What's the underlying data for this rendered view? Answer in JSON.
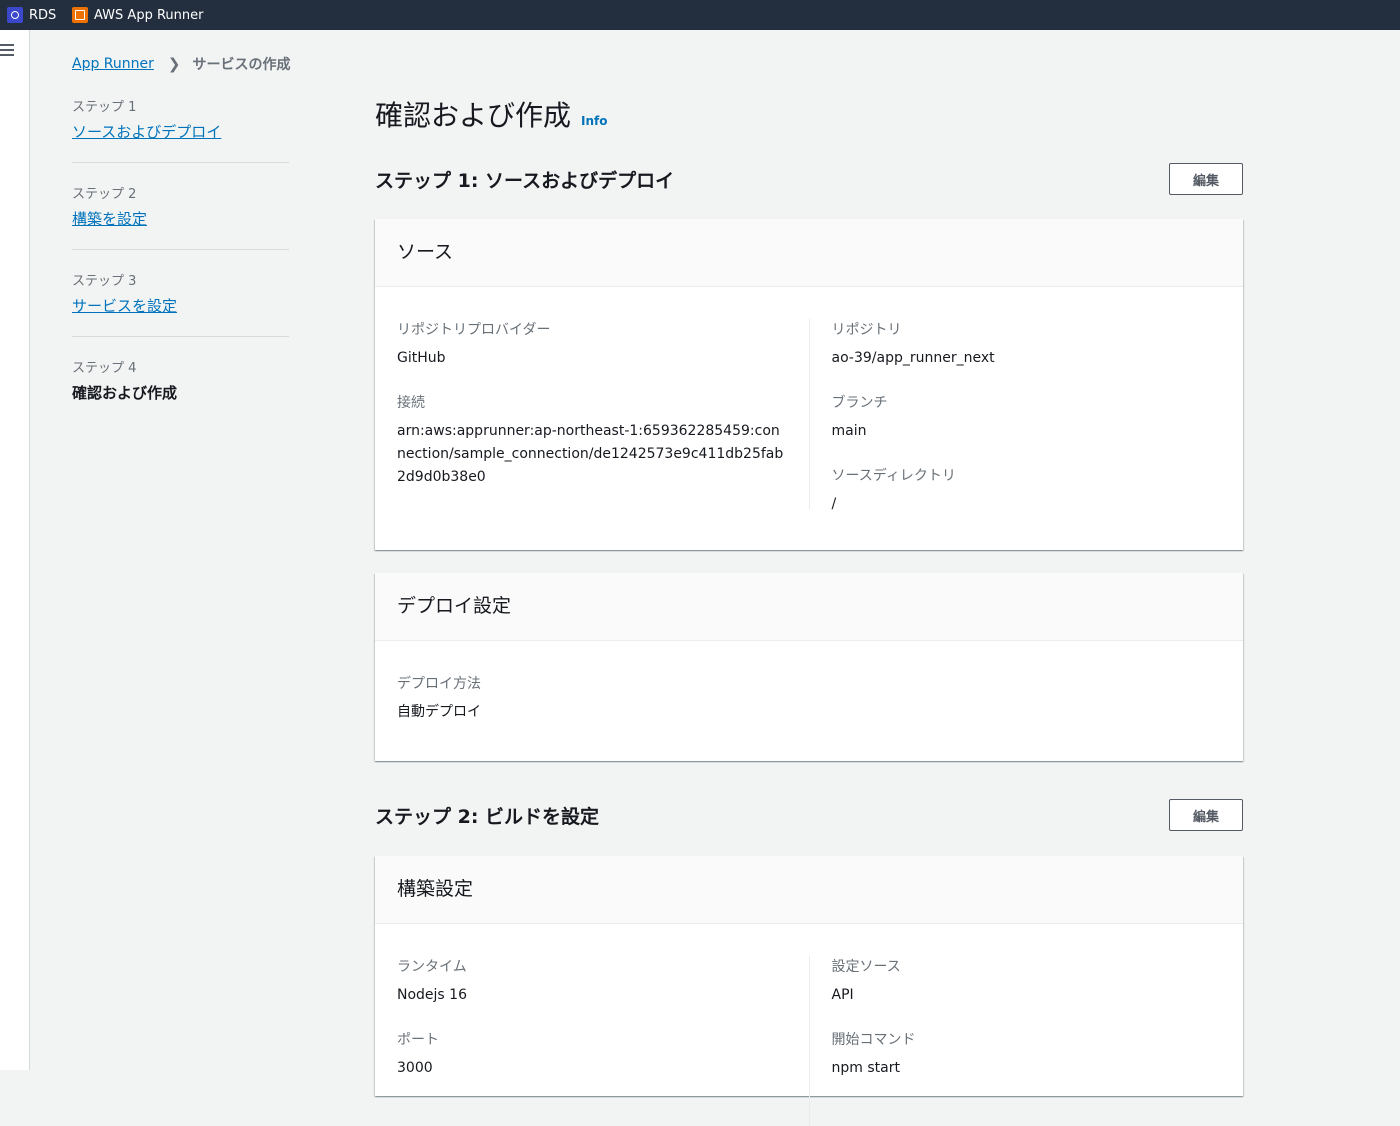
{
  "topbar": {
    "favorites": [
      {
        "icon": "rds-icon",
        "label": "RDS"
      },
      {
        "icon": "app-runner-icon",
        "label": "AWS App Runner"
      }
    ]
  },
  "breadcrumb": {
    "root": "App Runner",
    "current": "サービスの作成"
  },
  "steps": [
    {
      "label": "ステップ 1",
      "name": "ソースおよびデプロイ"
    },
    {
      "label": "ステップ 2",
      "name": "構築を設定"
    },
    {
      "label": "ステップ 3",
      "name": "サービスを設定"
    },
    {
      "label": "ステップ 4",
      "name": "確認および作成"
    }
  ],
  "page": {
    "title": "確認および作成",
    "info": "Info"
  },
  "step1": {
    "heading": "ステップ 1: ソースおよびデプロイ",
    "edit": "編集",
    "source": {
      "title": "ソース",
      "provider_label": "リポジトリプロバイダー",
      "provider_value": "GitHub",
      "connection_label": "接続",
      "connection_value": "arn:aws:apprunner:ap-northeast-1:659362285459:connection/sample_connection/de1242573e9c411db25fab2d9d0b38e0",
      "repo_label": "リポジトリ",
      "repo_value": "ao-39/app_runner_next",
      "branch_label": "ブランチ",
      "branch_value": "main",
      "dir_label": "ソースディレクトリ",
      "dir_value": "/"
    },
    "deploy": {
      "title": "デプロイ設定",
      "method_label": "デプロイ方法",
      "method_value": "自動デプロイ"
    }
  },
  "step2": {
    "heading": "ステップ 2: ビルドを設定",
    "edit": "編集",
    "build": {
      "title": "構築設定",
      "runtime_label": "ランタイム",
      "runtime_value": "Nodejs 16",
      "port_label": "ポート",
      "port_value": "3000",
      "config_label": "設定ソース",
      "config_value": "API",
      "start_label": "開始コマンド",
      "start_value": "npm start"
    }
  }
}
